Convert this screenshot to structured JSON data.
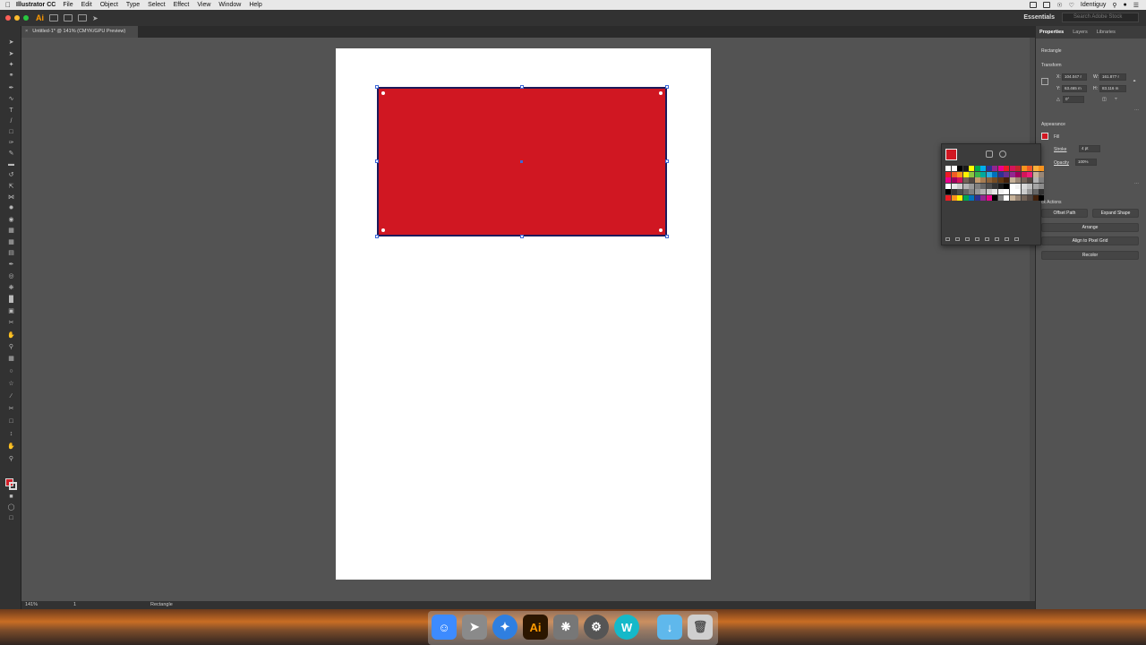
{
  "menubar": {
    "app_name": "Illustrator CC",
    "items": [
      "File",
      "Edit",
      "Object",
      "Type",
      "Select",
      "Effect",
      "View",
      "Window",
      "Help"
    ],
    "user": "Identiguy"
  },
  "appbar": {
    "logo": "Ai",
    "workspace": "Essentials",
    "search_placeholder": "Search Adobe Stock"
  },
  "document": {
    "tab_title": "Untitled-1* @ 141% (CMYK/GPU Preview)",
    "close_glyph": "×"
  },
  "statusbar": {
    "zoom": "141%",
    "artboard": "1",
    "tool": "Rectangle"
  },
  "panel": {
    "tabs": [
      "Properties",
      "Layers",
      "Libraries"
    ],
    "object_type": "Rectangle",
    "transform_title": "Transform",
    "x_label": "X:",
    "x_value": "104.047 r",
    "y_label": "Y:",
    "y_value": "63.465 m",
    "w_label": "W:",
    "w_value": "161.877 r",
    "h_label": "H:",
    "h_value": "83.116 m",
    "rotate_value": "0°",
    "appearance_title": "Appearance",
    "fill_label": "Fill",
    "stroke_label": "Stroke",
    "stroke_value": "4 pt",
    "opacity_label": "Opacity",
    "opacity_value": "100%",
    "quick_actions_title": "ck Actions",
    "offset_path": "Offset Path",
    "expand_shape": "Expand Shape",
    "arrange": "Arrange",
    "align_pixel": "Align to Pixel Grid",
    "recolor": "Recolor"
  },
  "colors": {
    "fill": "#d01722",
    "stroke": "#1e1a5a",
    "selection": "#3c68d8"
  },
  "swatches": [
    "#ffffff",
    "#ffffff",
    "#000000",
    "#1a1a1a",
    "#ffff00",
    "#00a651",
    "#00aeef",
    "#2e3192",
    "#92278f",
    "#ec008c",
    "#ed1c24",
    "#d4145a",
    "#c1272d",
    "#f7931e",
    "#f15a24",
    "#fbb03b",
    "#f7931e",
    "#ed1c24",
    "#f15a24",
    "#f7941d",
    "#fff200",
    "#8dc63f",
    "#39b54a",
    "#00a99d",
    "#29abe2",
    "#0071bc",
    "#2e3192",
    "#662d91",
    "#93278f",
    "#9e005d",
    "#d4145a",
    "#ed1e79",
    "#c7b299",
    "#998675",
    "#ec008c",
    "#9e005d",
    "#d4145a",
    "#736357",
    "#534741",
    "#c69c6d",
    "#a67c52",
    "#8c6239",
    "#754c24",
    "#603813",
    "#42210b",
    "#c7b299",
    "#998675",
    "#736357",
    "#534741",
    "#b3b3b3",
    "#808080",
    "#ffffff",
    "#e6e6e6",
    "#cccccc",
    "#b3b3b3",
    "#999999",
    "#808080",
    "#666666",
    "#4d4d4d",
    "#333333",
    "#1a1a1a",
    "#000000",
    "#ffffff",
    "#f2f2f2",
    "#d9d9d9",
    "#bfbfbf",
    "#a6a6a6",
    "#8c8c8c",
    "#000000",
    "#333333",
    "#4d4d4d",
    "#666666",
    "#808080",
    "#999999",
    "#b3b3b3",
    "#cccccc",
    "#e6e6e6",
    "#f2f2f2",
    "#ffffff",
    "#ffffff",
    "#ffffff",
    "#cccccc",
    "#999999",
    "#666666",
    "#333333",
    "#ed1c24",
    "#f7941d",
    "#fff200",
    "#00a651",
    "#0072bc",
    "#2e3192",
    "#92278f",
    "#ec008c",
    "#000000",
    "#808080",
    "#ffffff",
    "#c7b299",
    "#998675",
    "#736357",
    "#534741",
    "#42210b",
    "#000000"
  ],
  "dock": {
    "illustrator_label": "Ai",
    "w_label": "W"
  }
}
